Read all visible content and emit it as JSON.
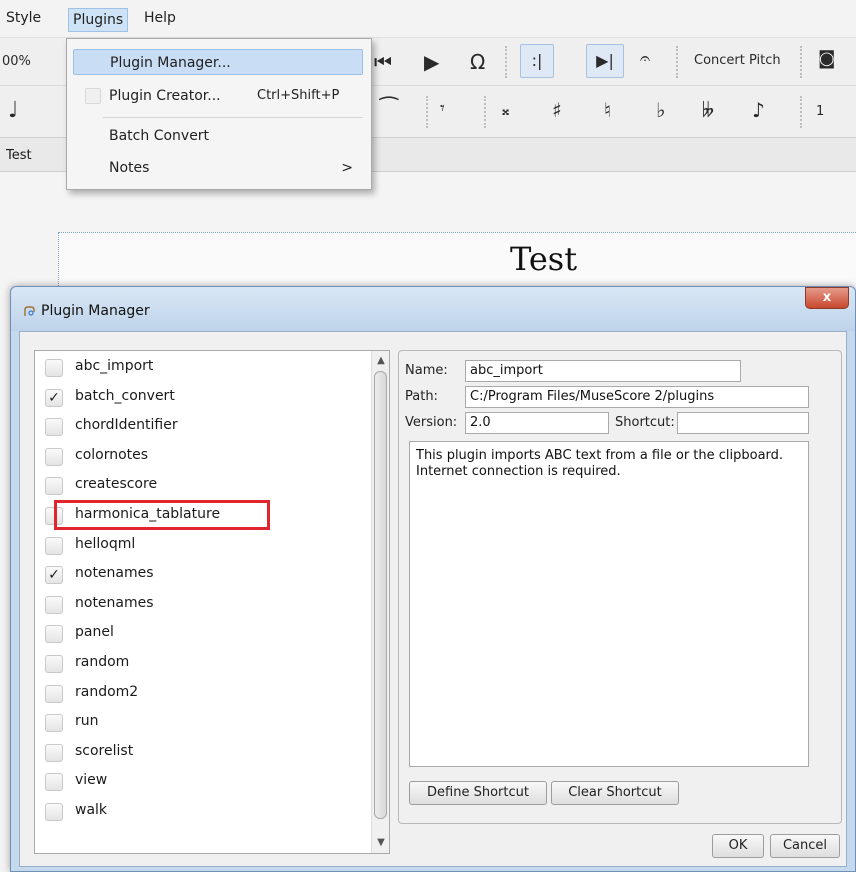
{
  "menubar": {
    "items": [
      {
        "label": "Style"
      },
      {
        "label": "Plugins"
      },
      {
        "label": "Help"
      }
    ]
  },
  "toolbar": {
    "zoom": "00%",
    "concert_pitch": "Concert Pitch",
    "voice_number": "1"
  },
  "tabbar": {
    "tab_label": "Test"
  },
  "score": {
    "title": "Test"
  },
  "plugins_menu": {
    "items": [
      {
        "label": "Plugin Manager...",
        "shortcut": ""
      },
      {
        "label": "Plugin Creator...",
        "shortcut": "Ctrl+Shift+P"
      },
      {
        "label": "Batch Convert",
        "shortcut": ""
      },
      {
        "label": "Notes",
        "shortcut": ""
      }
    ]
  },
  "dialog": {
    "title": "Plugin Manager",
    "close_label": "x",
    "plugins": [
      {
        "name": "abc_import",
        "checked": false
      },
      {
        "name": "batch_convert",
        "checked": true
      },
      {
        "name": "chordIdentifier",
        "checked": false
      },
      {
        "name": "colornotes",
        "checked": false
      },
      {
        "name": "createscore",
        "checked": false
      },
      {
        "name": "harmonica_tablature",
        "checked": false
      },
      {
        "name": "helloqml",
        "checked": false
      },
      {
        "name": "notenames",
        "checked": true
      },
      {
        "name": "notenames",
        "checked": false
      },
      {
        "name": "panel",
        "checked": false
      },
      {
        "name": "random",
        "checked": false
      },
      {
        "name": "random2",
        "checked": false
      },
      {
        "name": "run",
        "checked": false
      },
      {
        "name": "scorelist",
        "checked": false
      },
      {
        "name": "view",
        "checked": false
      },
      {
        "name": "walk",
        "checked": false
      }
    ],
    "details": {
      "name_label": "Name:",
      "name_value": "abc_import",
      "path_label": "Path:",
      "path_value": "C:/Program Files/MuseScore 2/plugins",
      "version_label": "Version:",
      "version_value": "2.0",
      "shortcut_label": "Shortcut:",
      "shortcut_value": "",
      "description": "This plugin imports ABC text from a file or the clipboard. Internet connection is required."
    },
    "buttons": {
      "define_shortcut": "Define Shortcut",
      "clear_shortcut": "Clear Shortcut",
      "ok": "OK",
      "cancel": "Cancel"
    }
  }
}
